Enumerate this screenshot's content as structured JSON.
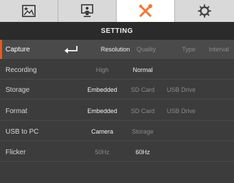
{
  "tabs": [
    {
      "icon": "image-icon"
    },
    {
      "icon": "presentation-icon"
    },
    {
      "icon": "tools-icon",
      "active": true
    },
    {
      "icon": "gear-icon"
    }
  ],
  "header": {
    "title": "SETTING"
  },
  "colors": {
    "accent": "#e85a1e",
    "tools_icon": "#f07a3a"
  },
  "rows": [
    {
      "label": "Capture",
      "options": [
        "Resolution",
        "Quality",
        "Type",
        "Interval"
      ],
      "selected": "Resolution"
    },
    {
      "label": "Recording",
      "options": [
        "High",
        "Normal"
      ],
      "selected": "Normal"
    },
    {
      "label": "Storage",
      "options": [
        "Embedded",
        "SD Card",
        "USB Drive"
      ],
      "selected": "Embedded"
    },
    {
      "label": "Format",
      "options": [
        "Embedded",
        "SD Card",
        "USB Drive"
      ],
      "selected": "Embedded"
    },
    {
      "label": "USB to PC",
      "options": [
        "Camera",
        "Storage"
      ],
      "selected": "Camera"
    },
    {
      "label": "Flicker",
      "options": [
        "50Hz",
        "60Hz"
      ],
      "selected": "60Hz"
    }
  ]
}
